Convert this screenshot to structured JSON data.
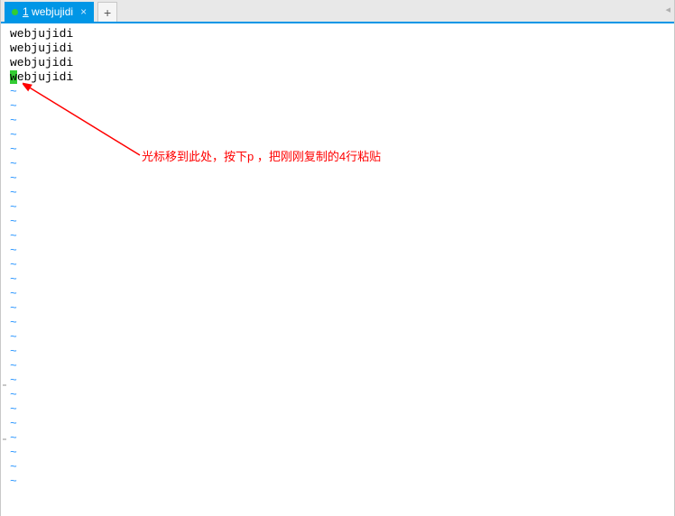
{
  "tab": {
    "index": "1",
    "name": "webjujidi",
    "close_glyph": "×",
    "modified": true
  },
  "newtab_glyph": "+",
  "tabright_glyph": "◂",
  "editor": {
    "lines": [
      "webjujidi",
      "webjujidi",
      "webjujidi",
      "webjujidi"
    ],
    "cursor": {
      "line": 3,
      "col": 0
    },
    "tilde": "~",
    "empty_rows": 28
  },
  "annotation": {
    "text": "光标移到此处，按下p ，把刚刚复制的4行粘贴"
  }
}
